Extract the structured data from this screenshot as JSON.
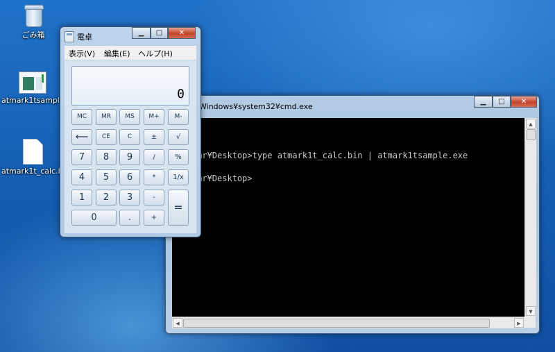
{
  "desktop": {
    "icons": [
      {
        "label": "ごみ箱",
        "icon": "recycle-bin-icon"
      },
      {
        "label": "atmark1tsample",
        "icon": "executable-icon"
      },
      {
        "label": "atmark1t_calc.bin",
        "icon": "file-icon"
      }
    ]
  },
  "calculator": {
    "title": "電卓",
    "menu": [
      "表示(V)",
      "編集(E)",
      "ヘルプ(H)"
    ],
    "display": "0",
    "keys": {
      "mc": "MC",
      "mr": "MR",
      "ms": "MS",
      "mplus": "M+",
      "mminus": "M-",
      "back": "⟵",
      "ce": "CE",
      "c": "C",
      "plusminus": "±",
      "sqrt": "√",
      "k7": "7",
      "k8": "8",
      "k9": "9",
      "div": "/",
      "pct": "%",
      "k4": "4",
      "k5": "5",
      "k6": "6",
      "mul": "*",
      "recip": "1/x",
      "k1": "1",
      "k2": "2",
      "k3": "3",
      "sub": "-",
      "eq": "=",
      "k0": "0",
      "dot": ".",
      "add": "+"
    }
  },
  "cmd": {
    "title": "Windows¥system32¥cmd.exe",
    "lines": [
      "rs¥fkmr¥Desktop>type atmark1t_calc.bin | atmark1tsample.exe",
      "rs¥fkmr¥Desktop>"
    ]
  },
  "window_buttons": {
    "minimize": "▁",
    "maximize": "□",
    "close": "✕"
  }
}
